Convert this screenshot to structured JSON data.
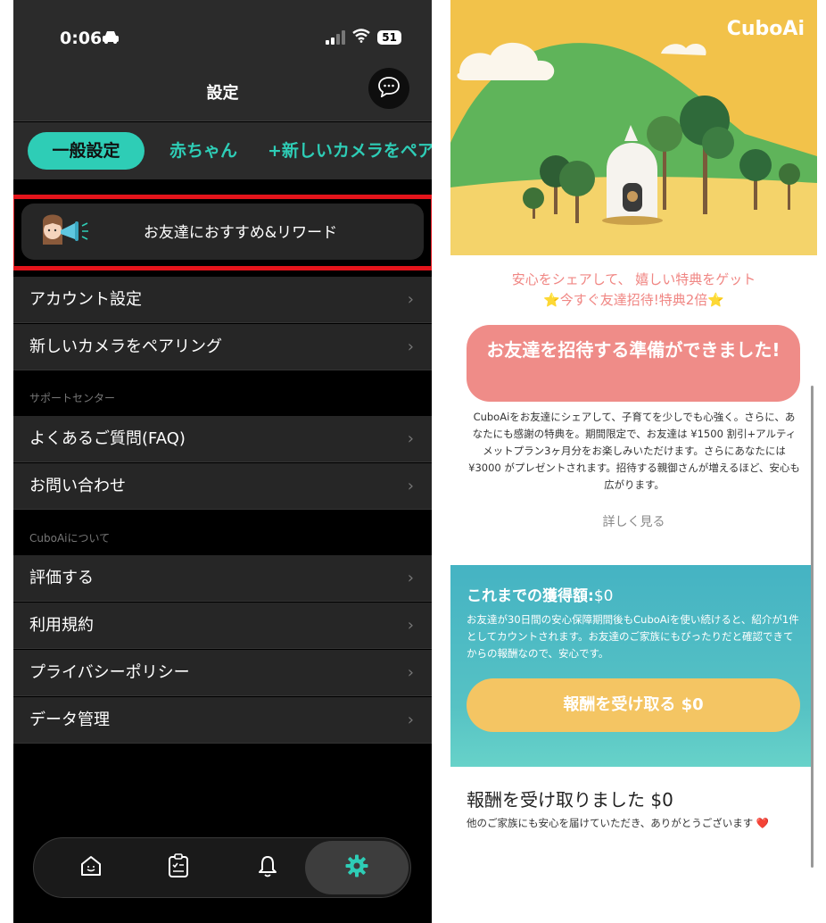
{
  "status_bar": {
    "time": "0:06",
    "battery": "51"
  },
  "nav": {
    "title": "設定"
  },
  "tabs": [
    {
      "label": "一般設定"
    },
    {
      "label": "赤ちゃん"
    },
    {
      "label": "+新しいカメラをペア"
    }
  ],
  "referral": {
    "label": "お友達におすすめ&リワード"
  },
  "menu": {
    "account": "アカウント設定",
    "pair_camera": "新しいカメラをペアリング",
    "support_header": "サポートセンター",
    "faq": "よくあるご質問(FAQ)",
    "contact": "お問い合わせ",
    "about_header": "CuboAiについて",
    "rate": "評価する",
    "terms": "利用規約",
    "privacy": "プライバシーポリシー",
    "data": "データ管理"
  },
  "tab_bar": [
    "home-icon",
    "checklist-icon",
    "bell-icon",
    "gear-icon"
  ],
  "right_page": {
    "brand": "CuboAi",
    "tagline_line1": "安心をシェアして、 嬉しい特典をゲット",
    "tagline_line2": "⭐今すぐ友達招待!特典2倍⭐",
    "invite_button": "お友達を招待する準備ができました!",
    "invite_desc": "CuboAiをお友達にシェアして、子育てを少しでも心強く。さらに、あなたにも感謝の特典を。期間限定で、お友達は ¥1500 割引+アルティメットプラン3ヶ月分をお楽しみいただけます。さらにあなたには ¥3000 がプレゼントされます。招待する親御さんが増えるほど、安心も広がります。",
    "more_link": "詳しく見る",
    "earned_label": "これまでの獲得額:",
    "earned_value": "$0",
    "earned_desc": "お友達が30日間の安心保障期間後もCuboAiを使い続けると、紹介が1件としてカウントされます。お友達のご家族にもぴったりだと確認できてからの報酬なので、安心です。",
    "claim_button": "報酬を受け取る $0",
    "received_title": "報酬を受け取りました $0",
    "received_desc": "他のご家族にも安心を届けていただき、ありがとうございます ❤️"
  },
  "colors": {
    "accent_teal": "#2ecdb6",
    "highlight_red": "#e4141b",
    "invite_pink": "#ef8c88",
    "claim_yellow": "#f4c563",
    "earn_teal": "#45b3c3"
  }
}
